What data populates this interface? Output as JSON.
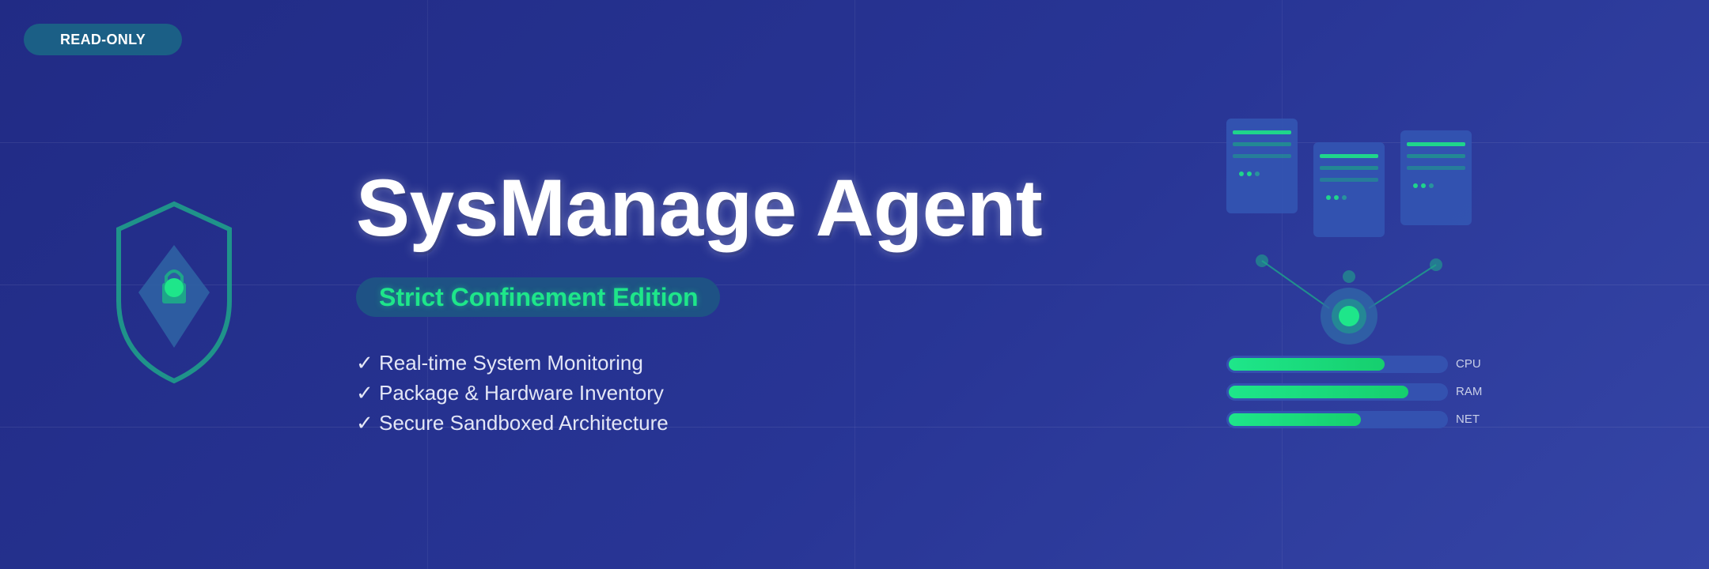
{
  "badge": {
    "label": "READ-ONLY"
  },
  "title": "SysManage Agent",
  "subtitle": "Strict Confinement Edition",
  "features": [
    "✓ Real-time System Monitoring",
    "✓ Package & Hardware Inventory",
    "✓ Secure Sandboxed Architecture"
  ],
  "meters": [
    {
      "label": "CPU",
      "level": 0.72
    },
    {
      "label": "RAM",
      "level": 0.83
    },
    {
      "label": "NET",
      "level": 0.61
    }
  ],
  "colors": {
    "background": "#2a3593",
    "accent_green": "#1ee68a",
    "badge_bg": "#1b5f86",
    "pill_bg": "#1e5285",
    "server_bg": "#3355b3"
  },
  "icons": {
    "shield": "shield-lock-icon",
    "servers": "server-icon",
    "network": "network-hub-icon"
  }
}
